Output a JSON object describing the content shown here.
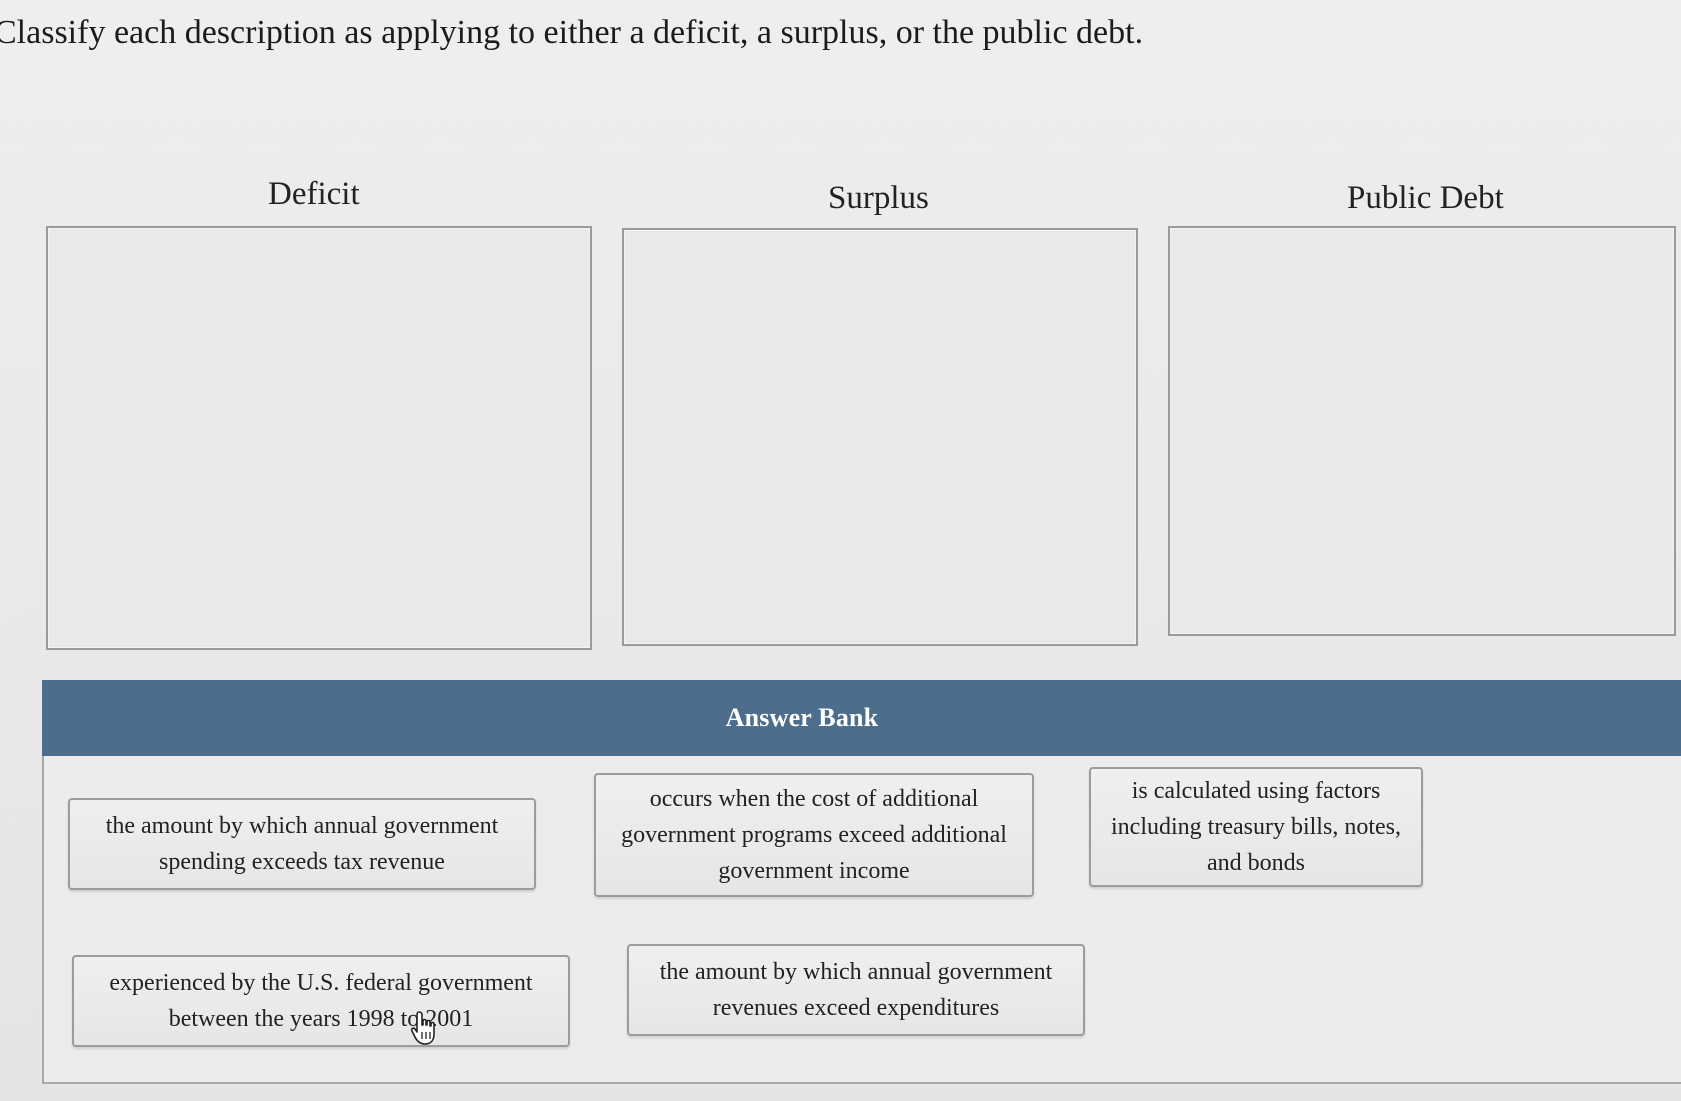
{
  "instruction": "Classify each description as applying to either a deficit, a surplus, or the public debt.",
  "categories": [
    {
      "label": "Deficit"
    },
    {
      "label": "Surplus"
    },
    {
      "label": "Public Debt"
    }
  ],
  "answer_bank": {
    "title": "Answer Bank",
    "items": [
      {
        "text": "the amount by which annual government spending exceeds tax revenue"
      },
      {
        "text": "occurs when the cost of additional government programs exceed additional government income"
      },
      {
        "text": "is calculated using factors including treasury bills, notes, and bonds"
      },
      {
        "text": "experienced by the U.S. federal government between the years 1998 to 2001"
      },
      {
        "text": "the amount by which annual government revenues exceed expenditures"
      }
    ]
  },
  "cursor": {
    "icon": "hand-pointer-icon"
  }
}
